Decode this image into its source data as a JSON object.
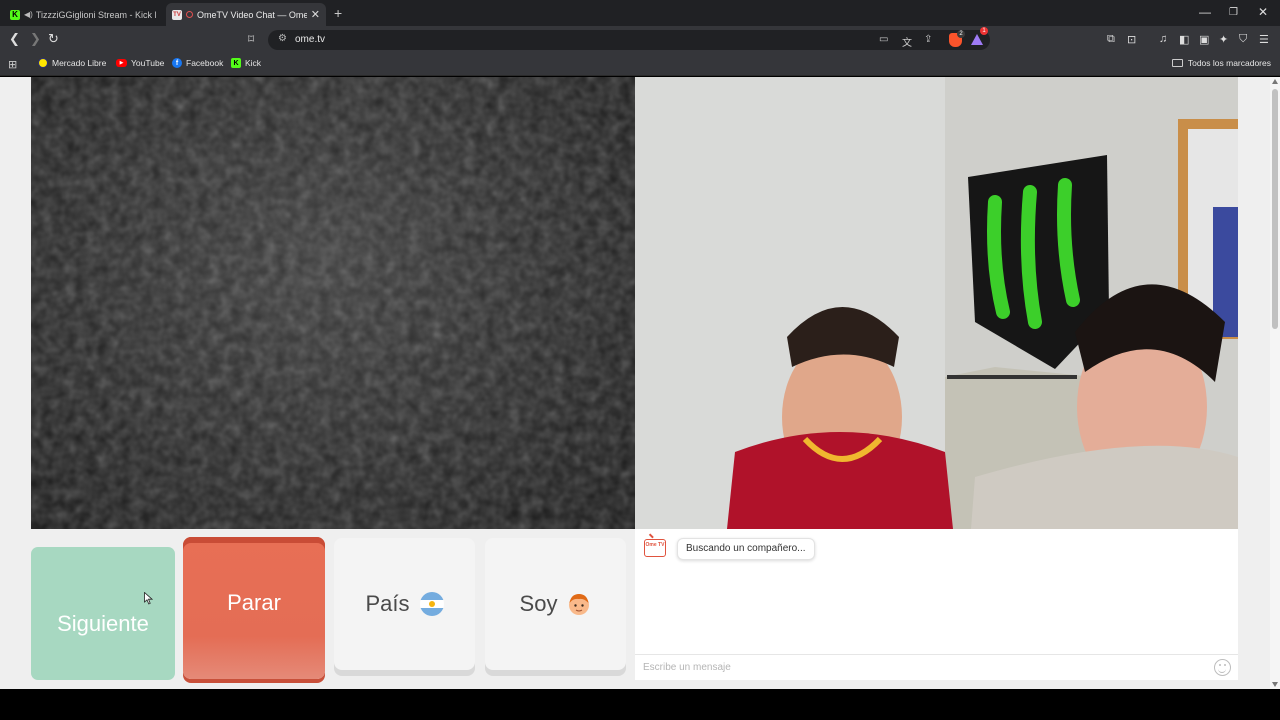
{
  "browser": {
    "tabs": [
      {
        "title": "TizzziGGiglioni Stream - Kick Das",
        "active": false
      },
      {
        "title": "OmeTV Video Chat — Omegl",
        "active": true
      }
    ],
    "url": "ome.tv",
    "brave_badge": "2",
    "rewards_badge": "1",
    "bookmarks": [
      "Mercado Libre",
      "YouTube",
      "Facebook",
      "Kick"
    ],
    "all_bookmarks_label": "Todos los marcadores"
  },
  "controls": {
    "next_label": "Siguiente",
    "stop_label": "Parar",
    "country_label": "País",
    "gender_label": "Soy"
  },
  "chat": {
    "status_message": "Buscando un compañero...",
    "input_placeholder": "Escribe un mensaje",
    "logo_text": "Ome TV"
  },
  "colors": {
    "next_button": "#a7d8c1",
    "stop_button": "#e46d55",
    "neutral_button": "#f4f4f4"
  }
}
